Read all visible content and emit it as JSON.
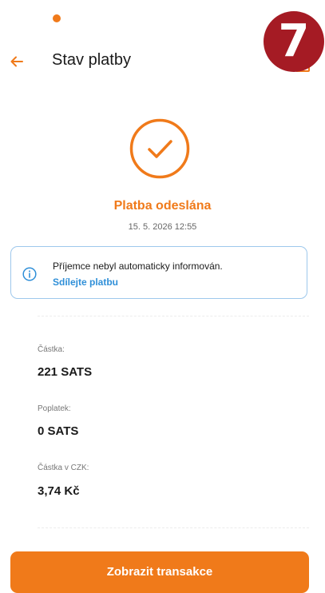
{
  "header": {
    "title": "Stav platby",
    "back_icon": "arrow-left-icon",
    "step_badge": "7"
  },
  "status": {
    "icon": "check-circle-icon",
    "title": "Platba odeslána",
    "timestamp": "15. 5. 2026 12:55"
  },
  "info": {
    "icon": "info-icon",
    "text": "Příjemce nebyl automaticky informován.",
    "link": "Sdílejte platbu"
  },
  "details": [
    {
      "label": "Částka:",
      "value": "221 SATS"
    },
    {
      "label": "Poplatek:",
      "value": "0 SATS"
    },
    {
      "label": "Částka v CZK:",
      "value": "3,74 Kč"
    }
  ],
  "actions": {
    "primary_label": "Zobrazit transakce"
  },
  "colors": {
    "accent": "#f07a1a",
    "info_border": "#9ec8ec",
    "link": "#2f8fd8",
    "badge": "#a51b24"
  }
}
